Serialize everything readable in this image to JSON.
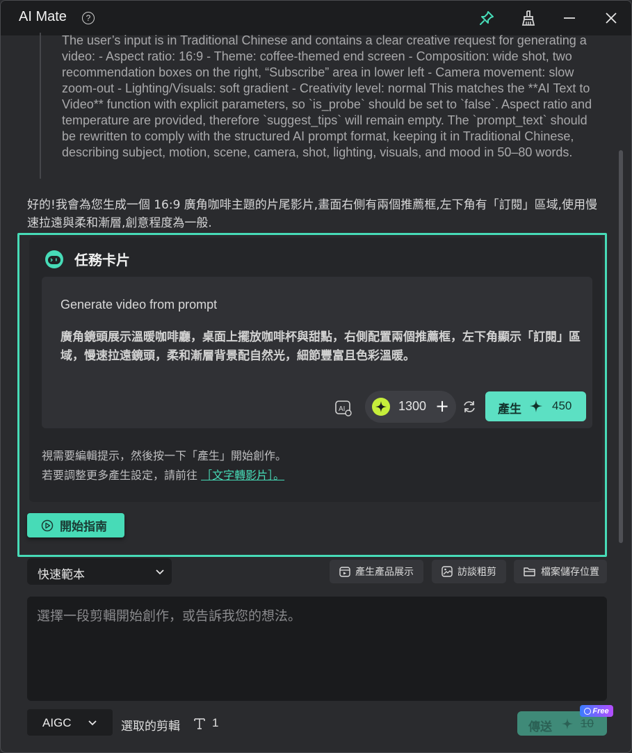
{
  "window": {
    "title": "AI Mate",
    "help_icon": "?",
    "buttons": [
      "pin-icon",
      "broom-icon",
      "minimize-icon",
      "close-icon"
    ]
  },
  "chat": {
    "reasoning": "The user’s input is in Traditional Chinese and contains a clear creative request for generating a video: - Aspect ratio: 16:9 - Theme: coffee-themed end screen - Composition: wide shot, two recommendation boxes on the right, “Subscribe” area in lower left - Camera movement: slow zoom-out - Lighting/Visuals: soft gradient - Creativity level: normal This matches the **AI Text to Video** function with explicit parameters, so `is_probe` should be set to `false`. Aspect ratio and temperature are provided, therefore `suggest_tips` will remain empty. The `prompt_text` should be rewritten to comply with the structured AI prompt format, keeping it in Traditional Chinese, describing subject, motion, scene, camera, shot, lighting, visuals, and mood in 50–80 words.",
    "reply": "好的!我會為您生成一個 16:9 廣角咖啡主題的片尾影片,畫面右側有兩個推薦框,左下角有「訂閱」區域,使用慢速拉遠與柔和漸層,創意程度為一般."
  },
  "task_card": {
    "title": "任務卡片",
    "prompt_label": "Generate video from prompt",
    "prompt_text": "廣角鏡頭展示溫暖咖啡廳，桌面上擺放咖啡杯與甜點，右側配置兩個推薦框，左下角顯示「訂閱」區域，慢速拉遠鏡頭，柔和漸層背景配自然光，細節豐富且色彩溫暖。",
    "credits": "1300",
    "credits_plus": "+",
    "generate_label": "產生",
    "generate_cost": "450",
    "hint_line1": "視需要編輯提示，然後按一下「產生」開始創作。",
    "hint_line2_prefix": "若要調整更多產生設定，請前往 ",
    "hint_link": "［文字轉影片］。",
    "guide_button": "開始指南"
  },
  "toolbar": {
    "quick_template": "快速範本",
    "chips": [
      "產生產品展示",
      "訪談粗剪",
      "檔案儲存位置"
    ]
  },
  "input": {
    "placeholder": "選擇一段剪輯開始創作，或告訴我您的想法。"
  },
  "bottom": {
    "mode": "AIGC",
    "selected_clip_label": "選取的剪輯",
    "selected_count": "1",
    "send_label": "傳送",
    "send_cost": "10",
    "free_badge": "Free"
  },
  "colors": {
    "accent": "#47dbb7",
    "credit_star": "#c6ee3b",
    "background": "#2a2b2e",
    "titlebar": "#1c1d1f"
  }
}
